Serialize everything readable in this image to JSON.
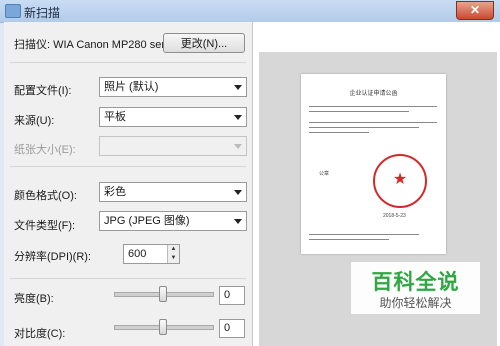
{
  "window": {
    "title": "新扫描",
    "close_glyph": "✕"
  },
  "scanner": {
    "label": "扫描仪: WIA Canon MP280 ser",
    "change_button": "更改(N)..."
  },
  "settings": {
    "profile": {
      "label": "配置文件(I):",
      "value": "照片 (默认)"
    },
    "source": {
      "label": "来源(U):",
      "value": "平板"
    },
    "paper_size": {
      "label": "纸张大小(E):",
      "value": ""
    },
    "color_format": {
      "label": "颜色格式(O):",
      "value": "彩色"
    },
    "file_type": {
      "label": "文件类型(F):",
      "value": "JPG (JPEG 图像)"
    },
    "resolution": {
      "label": "分辨率(DPI)(R):",
      "value": "600"
    },
    "brightness": {
      "label": "亮度(B):",
      "value": "0",
      "level": 0.5
    },
    "contrast": {
      "label": "对比度(C):",
      "value": "0",
      "level": 0.5
    }
  },
  "preview": {
    "document_title": "企业认证申请公函",
    "document_signature": "公章",
    "document_date": "2018-5-23"
  },
  "watermark": {
    "title": "百科全说",
    "subtitle": "助你轻松解决"
  },
  "colors": {
    "accent_green": "#2fa843",
    "seal_red": "#d12a2a"
  }
}
